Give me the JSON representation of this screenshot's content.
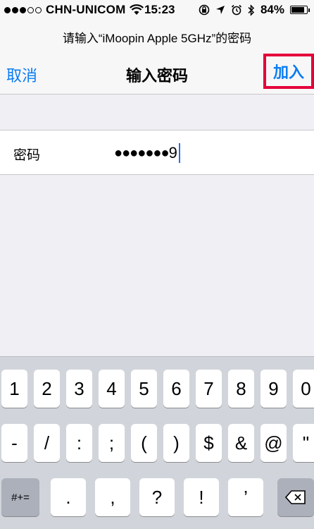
{
  "status_bar": {
    "signal_filled": 3,
    "signal_total": 5,
    "carrier": "CHN-UNICOM",
    "time": "15:23",
    "battery_percent": "84%",
    "battery_level": 0.84,
    "icons": [
      "wifi-icon",
      "rotation-lock-icon",
      "location-icon",
      "alarm-icon",
      "bluetooth-icon",
      "battery-icon"
    ]
  },
  "header": {
    "prompt": "请输入“iMoopin Apple 5GHz”的密码",
    "title": "输入密码",
    "cancel_label": "取消",
    "join_label": "加入",
    "accent_color": "#0a7cf3",
    "highlight_color": "#e5003a"
  },
  "password_row": {
    "label": "密码",
    "masked_value": "●●●●●●●",
    "last_char": "9"
  },
  "keyboard": {
    "row1": [
      "1",
      "2",
      "3",
      "4",
      "5",
      "6",
      "7",
      "8",
      "9",
      "0"
    ],
    "row2": [
      "-",
      "/",
      ":",
      ";",
      "(",
      ")",
      "$",
      "&",
      "@",
      "\""
    ],
    "row3_mode_label": "#+=",
    "row3": [
      ".",
      ",",
      "?",
      "!",
      "’"
    ],
    "delete_icon": "delete-icon"
  }
}
